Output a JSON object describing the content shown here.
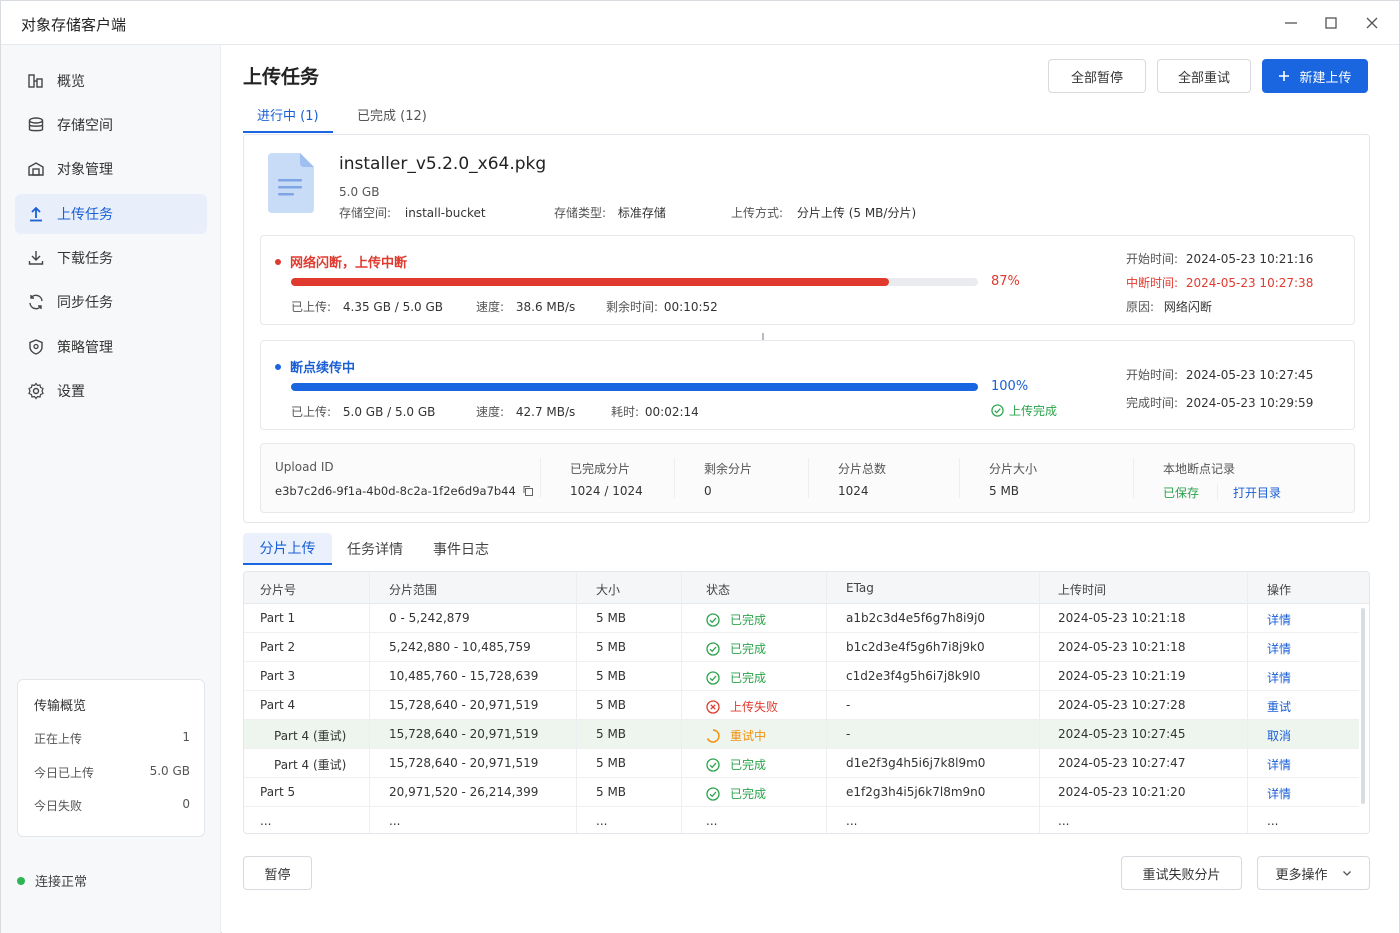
{
  "app": {
    "title": "对象存储客户端"
  },
  "sidebar": {
    "items": [
      {
        "label": "概览",
        "icon": "overview-icon"
      },
      {
        "label": "存储空间",
        "icon": "storage-icon"
      },
      {
        "label": "对象管理",
        "icon": "object-icon"
      },
      {
        "label": "上传任务",
        "icon": "upload-icon",
        "active": true
      },
      {
        "label": "下载任务",
        "icon": "download-icon"
      },
      {
        "label": "同步任务",
        "icon": "sync-icon"
      },
      {
        "label": "策略管理",
        "icon": "policy-icon"
      },
      {
        "label": "设置",
        "icon": "gear-icon"
      }
    ],
    "overview": {
      "title": "传输概览",
      "rows": [
        {
          "label": "正在上传",
          "value": "1"
        },
        {
          "label": "今日已上传",
          "value": "5.0 GB"
        },
        {
          "label": "今日失败",
          "value": "0"
        }
      ]
    },
    "connection": "连接正常"
  },
  "header": {
    "title": "上传任务",
    "buttons": {
      "pause_all": "全部暂停",
      "retry_all": "全部重试",
      "new_upload": "新建上传"
    }
  },
  "tabs": [
    {
      "label": "进行中 (1)",
      "active": true
    },
    {
      "label": "已完成 (12)"
    }
  ],
  "task": {
    "file_name": "installer_v5.2.0_x64.pkg",
    "size": "5.0 GB",
    "bucket_label": "存储空间:",
    "bucket": "install-bucket",
    "storage_type_label": "存储类型:",
    "storage_type": "标准存储",
    "upload_mode_label": "上传方式:",
    "upload_mode": "分片上传 (5 MB/分片)",
    "interrupted": {
      "title": "网络闪断，上传中断",
      "progress": 0.87,
      "percent": "87%",
      "uploaded_label": "已上传:",
      "uploaded": "4.35 GB / 5.0 GB",
      "speed_label": "速度:",
      "speed": "38.6 MB/s",
      "remaining_label": "剩余时间:",
      "remaining": "00:10:52",
      "start_label": "开始时间:",
      "start": "2024-05-23 10:21:16",
      "break_label": "中断时间:",
      "break_time": "2024-05-23 10:27:38",
      "reason_label": "原因:",
      "reason": "网络闪断"
    },
    "resumed": {
      "title": "断点续传中",
      "progress": 1.0,
      "percent": "100%",
      "done_text": "上传完成",
      "uploaded_label": "已上传:",
      "uploaded": "5.0 GB / 5.0 GB",
      "speed_label": "速度:",
      "speed": "42.7 MB/s",
      "elapsed_label": "耗时:",
      "elapsed": "00:02:14",
      "start_label": "开始时间:",
      "start": "2024-05-23 10:27:45",
      "finish_label": "完成时间:",
      "finish": "2024-05-23 10:29:59"
    },
    "summary": {
      "upload_id_label": "Upload ID",
      "upload_id": "e3b7c2d6-9f1a-4b0d-8c2a-1f2e6d9a7b44",
      "completed_parts_label": "已完成分片",
      "completed_parts": "1024 / 1024",
      "remaining_parts_label": "剩余分片",
      "remaining_parts": "0",
      "total_parts_label": "分片总数",
      "total_parts": "1024",
      "part_size_label": "分片大小",
      "part_size": "5 MB",
      "checkpoint_label": "本地断点记录",
      "checkpoint_saved": "已保存",
      "open_dir": "打开目录"
    }
  },
  "subtabs": [
    {
      "label": "分片上传",
      "active": true
    },
    {
      "label": "任务详情"
    },
    {
      "label": "事件日志"
    }
  ],
  "table": {
    "headers": [
      "分片号",
      "分片范围",
      "大小",
      "状态",
      "ETag",
      "上传时间",
      "操作"
    ],
    "rows": [
      {
        "part": "Part 1",
        "range": "0 - 5,242,879",
        "size": "5 MB",
        "status": "已完成",
        "state": "ok",
        "etag": "a1b2c3d4e5f6g7h8i9j0",
        "time": "2024-05-23 10:21:18",
        "action": "详情"
      },
      {
        "part": "Part 2",
        "range": "5,242,880 - 10,485,759",
        "size": "5 MB",
        "status": "已完成",
        "state": "ok",
        "etag": "b1c2d3e4f5g6h7i8j9k0",
        "time": "2024-05-23 10:21:18",
        "action": "详情"
      },
      {
        "part": "Part 3",
        "range": "10,485,760 - 15,728,639",
        "size": "5 MB",
        "status": "已完成",
        "state": "ok",
        "etag": "c1d2e3f4g5h6i7j8k9l0",
        "time": "2024-05-23 10:21:19",
        "action": "详情"
      },
      {
        "part": "Part 4",
        "range": "15,728,640 - 20,971,519",
        "size": "5 MB",
        "status": "上传失败",
        "state": "fail",
        "etag": "-",
        "time": "2024-05-23 10:27:28",
        "action": "重试"
      },
      {
        "part": "Part 4 (重试)",
        "range": "15,728,640 - 20,971,519",
        "size": "5 MB",
        "status": "重试中",
        "state": "retry",
        "etag": "-",
        "time": "2024-05-23 10:27:45",
        "action": "取消",
        "indent": true
      },
      {
        "part": "Part 4 (重试)",
        "range": "15,728,640 - 20,971,519",
        "size": "5 MB",
        "status": "已完成",
        "state": "ok",
        "etag": "d1e2f3g4h5i6j7k8l9m0",
        "time": "2024-05-23 10:27:47",
        "action": "详情",
        "indent": true
      },
      {
        "part": "Part 5",
        "range": "20,971,520 - 26,214,399",
        "size": "5 MB",
        "status": "已完成",
        "state": "ok",
        "etag": "e1f2g3h4i5j6k7l8m9n0",
        "time": "2024-05-23 10:21:20",
        "action": "详情"
      },
      {
        "part": "...",
        "range": "...",
        "size": "...",
        "status": "...",
        "state": "none",
        "etag": "...",
        "time": "...",
        "action": "..."
      }
    ]
  },
  "footer": {
    "pause": "暂停",
    "retry_failed": "重试失败分片",
    "more": "更多操作"
  },
  "colors": {
    "accent": "#1a66e0",
    "error": "#e03a2f",
    "success": "#2aa34a",
    "warning": "#f0910d"
  }
}
